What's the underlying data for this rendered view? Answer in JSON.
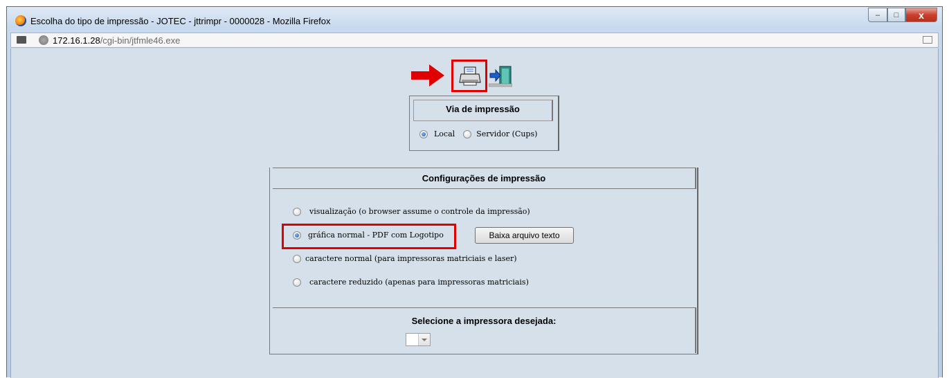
{
  "window": {
    "title": "Escolha do tipo de impressão - JOTEC - jttrimpr - 0000028 - Mozilla Firefox",
    "controls": {
      "minimize": "–",
      "maximize": "□",
      "close": "x"
    }
  },
  "urlbar": {
    "host": "172.16.1.28",
    "path": "/cgi-bin/jtfmle46.exe"
  },
  "toolbar": {
    "print_icon": "printer-icon",
    "exit_icon": "exit-door-icon",
    "annotation_color": "#e00000"
  },
  "via": {
    "title": "Via de impressão",
    "options": [
      {
        "label": "Local",
        "checked": true
      },
      {
        "label": "Servidor (Cups)",
        "checked": false
      }
    ]
  },
  "config": {
    "title": "Configurações de impressão",
    "options": [
      {
        "label": "visualização (o browser assume o controle da impressão)",
        "checked": false
      },
      {
        "label": "gráfica normal - PDF com Logotipo",
        "checked": true
      },
      {
        "label": "caractere normal (para impressoras matriciais e laser)",
        "checked": false
      },
      {
        "label": "caractere reduzido (apenas para impressoras matriciais)",
        "checked": false
      }
    ],
    "download_button": "Baixa arquivo texto",
    "printer_select_label": "Selecione a impressora desejada:",
    "printer_select_value": ""
  }
}
